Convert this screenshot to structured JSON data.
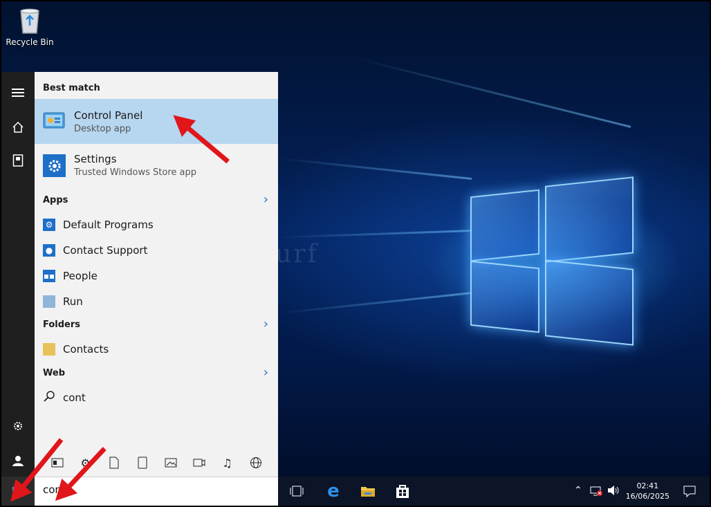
{
  "desktop": {
    "recycle_bin_label": "Recycle Bin",
    "watermark": "nurf"
  },
  "rail": {
    "icons": [
      "hamburger-menu-icon",
      "home-icon",
      "notebook-icon",
      "gear-icon",
      "user-icon",
      "windows-logo-icon"
    ]
  },
  "start_menu": {
    "best_match_header": "Best match",
    "best_match": {
      "title": "Control Panel",
      "subtitle": "Desktop app"
    },
    "settings": {
      "title": "Settings",
      "subtitle": "Trusted Windows Store app"
    },
    "apps_header": "Apps",
    "apps": [
      "Default Programs",
      "Contact Support",
      "People",
      "Run"
    ],
    "folders_header": "Folders",
    "folders": [
      "Contacts"
    ],
    "web_header": "Web",
    "web": [
      "cont"
    ],
    "filters": [
      "office-icon",
      "settings-icon",
      "document-icon",
      "tablet-icon",
      "photo-icon",
      "video-icon",
      "music-icon",
      "globe-icon"
    ]
  },
  "search": {
    "value": "cont"
  },
  "taskbar": {
    "apps": [
      "task-view-icon",
      "edge-icon",
      "file-explorer-icon",
      "store-icon"
    ],
    "time": "02:41",
    "date": "16/06/2025"
  },
  "colors": {
    "accent": "#1e6fc8",
    "highlight": "#b7d6ef",
    "arrow": "#e0161a"
  }
}
